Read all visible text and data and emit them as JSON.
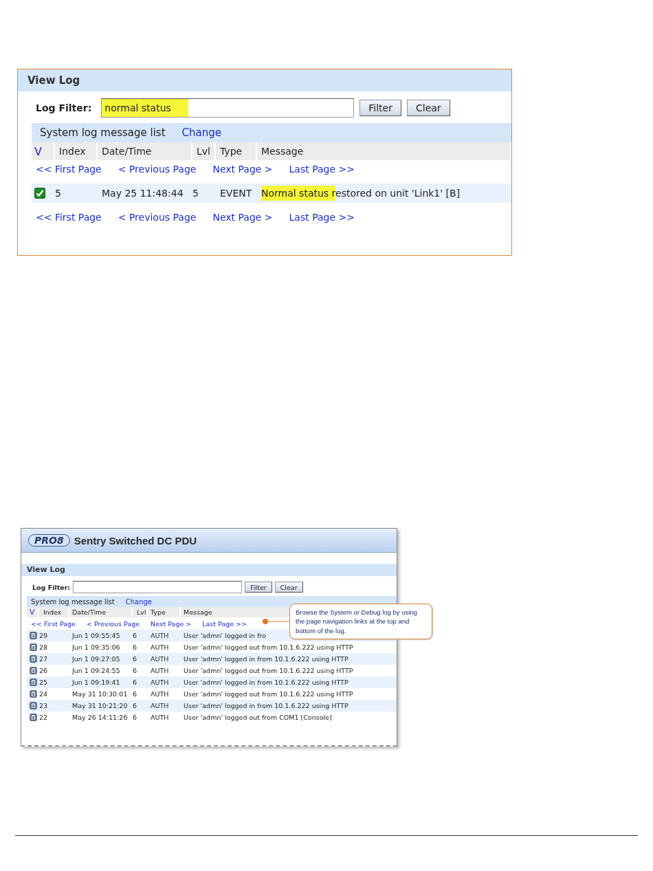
{
  "screenshots": [
    {
      "title": "View Log",
      "filter": {
        "label": "Log Filter:",
        "value": "normal status",
        "highlighted": true
      },
      "buttons": [
        "Filter",
        "Clear"
      ],
      "list_title": "System log message list",
      "change_link": "Change",
      "columns": [
        "V",
        "Index",
        "Date/Time",
        "Lvl",
        "Type",
        "Message"
      ],
      "nav_top": [
        "<< First Page",
        "< Previous Page",
        "Next Page >",
        "Last Page >>"
      ],
      "rows": [
        {
          "kind": "event",
          "index": "5",
          "datetime": "May 25 11:48:44",
          "lvl": "5",
          "type": "EVENT",
          "message_highlight": "Normal status r",
          "message": "estored on unit 'Link1' [B]"
        }
      ],
      "nav_bottom": [
        "<< First Page",
        "< Previous Page",
        "Next Page >",
        "Last Page >>"
      ]
    },
    {
      "header": {
        "logo": "PRO8",
        "title": "Sentry Switched DC PDU"
      },
      "title": "View Log",
      "filter": {
        "label": "Log Filter:"
      },
      "buttons": [
        "Filter",
        "Clear"
      ],
      "list_title": "System log message list",
      "change_link": "Change",
      "columns": [
        "V",
        "Index",
        "Date/Time",
        "Lvl",
        "Type",
        "Message"
      ],
      "nav_top": [
        "<< First Page",
        "< Previous Page",
        "Next Page >",
        "Last Page >>"
      ],
      "callout": "Browse the System or Debug log by using the page navigation links at the top and bottom of the log.",
      "rows": [
        {
          "kind": "info",
          "index": "29",
          "datetime": "Jun 1 09:55:45",
          "lvl": "6",
          "type": "AUTH",
          "message": "User 'admn' logged in fro"
        },
        {
          "kind": "info",
          "index": "28",
          "datetime": "Jun 1 09:35:06",
          "lvl": "6",
          "type": "AUTH",
          "message": "User 'admn' logged out from 10.1.6.222 using HTTP"
        },
        {
          "kind": "info",
          "index": "27",
          "datetime": "Jun 1 09:27:05",
          "lvl": "6",
          "type": "AUTH",
          "message": "User 'admn' logged in from 10.1.6.222 using HTTP"
        },
        {
          "kind": "info",
          "index": "26",
          "datetime": "Jun 1 09:24:55",
          "lvl": "6",
          "type": "AUTH",
          "message": "User 'admn' logged out from 10.1.6.222 using HTTP"
        },
        {
          "kind": "info",
          "index": "25",
          "datetime": "Jun 1 09:19:41",
          "lvl": "6",
          "type": "AUTH",
          "message": "User 'admn' logged in from 10.1.6.222 using HTTP"
        },
        {
          "kind": "info",
          "index": "24",
          "datetime": "May 31 10:30:01",
          "lvl": "6",
          "type": "AUTH",
          "message": "User 'admn' logged out from 10.1.6.222 using HTTP"
        },
        {
          "kind": "info",
          "index": "23",
          "datetime": "May 31 10:21:20",
          "lvl": "6",
          "type": "AUTH",
          "message": "User 'admn' logged in from 10.1.6.222 using HTTP"
        },
        {
          "kind": "info",
          "index": "22",
          "datetime": "May 26 14:11:26",
          "lvl": "6",
          "type": "AUTH",
          "message": "User 'admn' logged out from COM1 [Console]"
        }
      ]
    }
  ]
}
